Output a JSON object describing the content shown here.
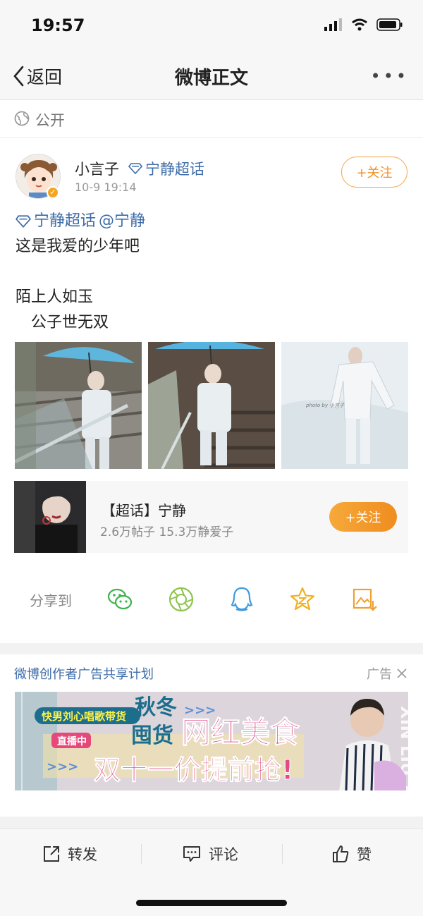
{
  "status": {
    "time": "19:57"
  },
  "nav": {
    "back_label": "返回",
    "title": "微博正文"
  },
  "visibility": {
    "label": "公开"
  },
  "author": {
    "name": "小言子",
    "topic": "宁静超话",
    "time": "10-9 19:14",
    "follow_label": "+关注"
  },
  "post": {
    "tag_topic": "宁静超话",
    "mention": "@宁静",
    "lines": [
      "这是我爱的少年吧",
      "",
      "陌上人如玉",
      "　公子世无双"
    ]
  },
  "photos": {
    "watermark": "photo by 小言子"
  },
  "super_topic": {
    "title": "【超话】宁静",
    "stats": "2.6万帖子 15.3万静爱子",
    "follow_label": "+关注"
  },
  "share": {
    "label": "分享到",
    "icons": [
      "wechat-icon",
      "moments-icon",
      "qq-icon",
      "qzone-icon",
      "save-image-icon"
    ]
  },
  "ad": {
    "plan_label": "微博创作者广告共享计划",
    "ad_label": "广告",
    "banner": {
      "tag1": "快男刘心唱歌带货",
      "tag2": "直播中",
      "t1": "秋冬",
      "t2": "囤货",
      "headline1": "网红美食",
      "headline2": "双十一价提前抢!",
      "arrows": ">>>",
      "side_text": "XIN LIU XIN"
    }
  },
  "bottom": {
    "repost": "转发",
    "comment": "评论",
    "like": "赞"
  },
  "colors": {
    "link": "#3d6ca8",
    "orange": "#f0902a",
    "muted": "#888888"
  }
}
